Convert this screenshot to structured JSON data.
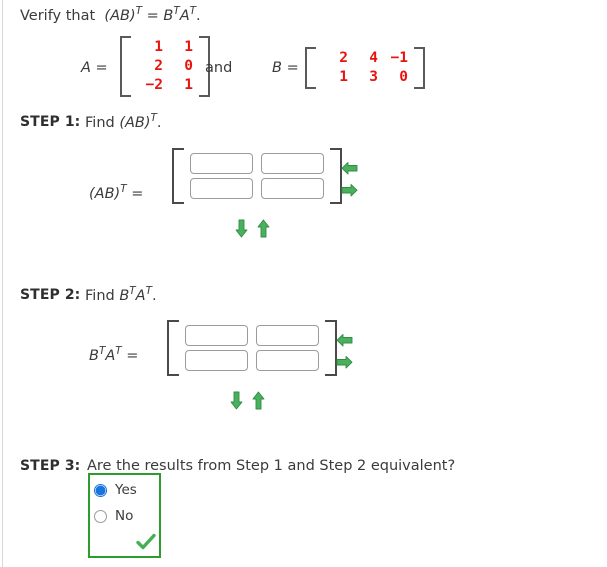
{
  "problem": {
    "prompt_lead": "Verify that",
    "prompt_expr_left": "(AB)",
    "prompt_eq": "=",
    "prompt_expr_right_b": "B",
    "prompt_expr_right_a": "A",
    "prompt_period": ".",
    "T": "T",
    "and_label": "and"
  },
  "matrix_a": {
    "name": "A",
    "equals": "=",
    "rows": [
      [
        "1",
        "1"
      ],
      [
        "2",
        "0"
      ],
      [
        "−2",
        "1"
      ]
    ],
    "color": "#e8130f"
  },
  "matrix_b": {
    "name": "B",
    "equals": "=",
    "rows": [
      [
        "2",
        "4",
        "−1"
      ],
      [
        "1",
        "3",
        "0"
      ]
    ],
    "color": "#e8130f"
  },
  "step1": {
    "label": "STEP 1:",
    "instruction_find": "Find",
    "instruction_expr": "(AB)",
    "instruction_period": ".",
    "answer_label_expr": "(AB)",
    "answer_label_eq": "=",
    "cells": [
      [
        "",
        ""
      ],
      [
        "",
        ""
      ]
    ],
    "placeholder": "",
    "controls": {
      "remove_column": "left-arrow",
      "add_column": "right-arrow",
      "add_row": "down-arrow",
      "remove_row": "up-arrow"
    }
  },
  "step2": {
    "label": "STEP 2:",
    "instruction_find": "Find",
    "instruction_b": "B",
    "instruction_a": "A",
    "instruction_period": ".",
    "answer_label_b": "B",
    "answer_label_a": "A",
    "answer_label_eq": "=",
    "cells": [
      [
        "",
        ""
      ],
      [
        "",
        ""
      ]
    ],
    "placeholder": "",
    "controls": {
      "remove_column": "left-arrow",
      "add_column": "right-arrow",
      "add_row": "down-arrow",
      "remove_row": "up-arrow"
    }
  },
  "step3": {
    "label": "STEP 3:",
    "question": "Are the results from Step 1 and Step 2 equivalent?",
    "options": [
      {
        "label": "Yes",
        "selected": true
      },
      {
        "label": "No",
        "selected": false
      }
    ],
    "status_icon": "green-check",
    "box_border_color": "#2e9b2e"
  },
  "colors": {
    "matrix_red": "#e8130f",
    "arrow_green": "#3fae53",
    "check_green": "#3eae46",
    "correct_border": "#2e9b2e",
    "radio_blue": "#1775e0"
  }
}
